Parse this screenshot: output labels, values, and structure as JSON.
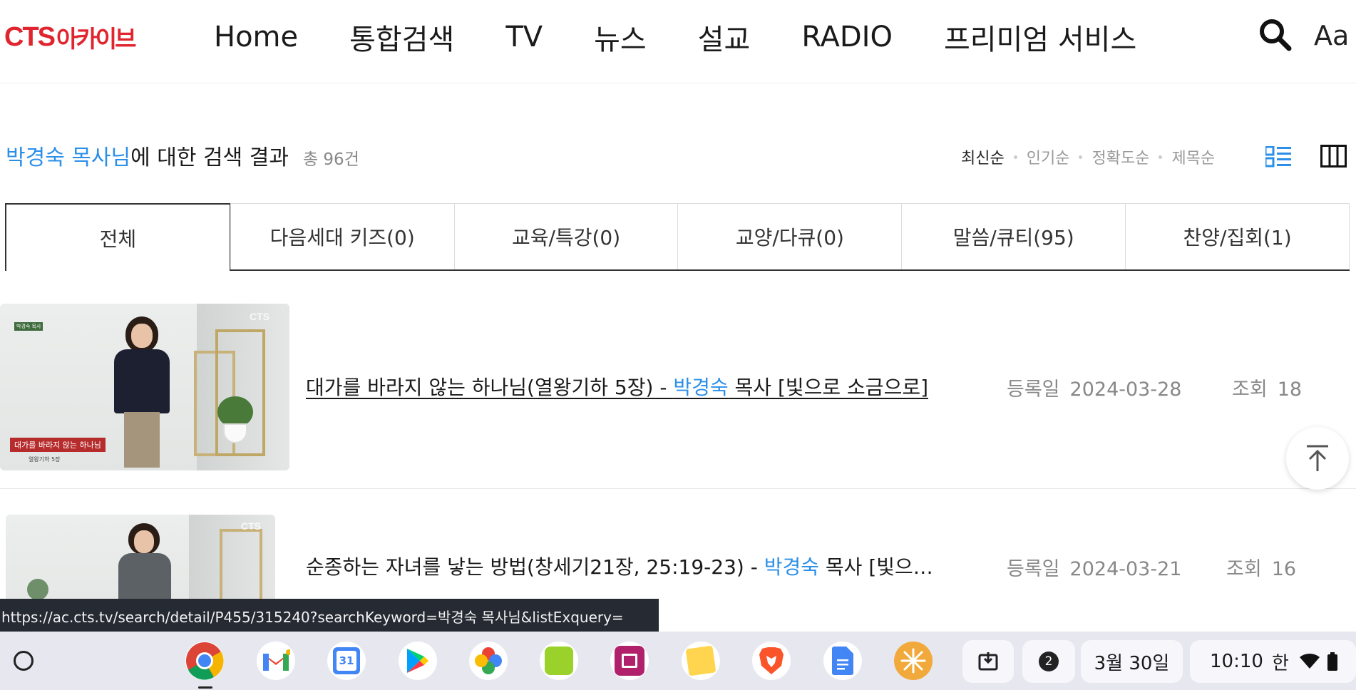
{
  "header": {
    "logo_cts": "CTS",
    "logo_archive": "아카이브",
    "nav": [
      {
        "label": "Home"
      },
      {
        "label": "통합검색"
      },
      {
        "label": "TV"
      },
      {
        "label": "뉴스"
      },
      {
        "label": "설교"
      },
      {
        "label": "RADIO"
      },
      {
        "label": "프리미엄 서비스"
      }
    ],
    "search_icon": "search-icon",
    "font_size_label": "Aa"
  },
  "results": {
    "keyword": "박경숙 목사님",
    "suffix": "에 대한 검색 결과",
    "total": "총 96건"
  },
  "sort": {
    "options": [
      "최신순",
      "인기순",
      "정확도순",
      "제목순"
    ],
    "active": "최신순"
  },
  "tabs": [
    {
      "label": "전체",
      "active": true
    },
    {
      "label": "다음세대 키즈(0)"
    },
    {
      "label": "교육/특강(0)"
    },
    {
      "label": "교양/다큐(0)"
    },
    {
      "label": "말씀/큐티(95)"
    },
    {
      "label": "찬양/집회(1)"
    }
  ],
  "items": [
    {
      "title_before": "대가를 바라지 않는 하나님(열왕기하 5장) - ",
      "title_keyword": "박경숙",
      "title_after": " 목사 [빛으로 소금으로]",
      "date_label": "등록일",
      "date": "2024-03-28",
      "views_label": "조회",
      "views": "18",
      "thumb_caption": "대가를 바라지 않는 하나님",
      "thumb_sub": "열왕기하 5장",
      "thumb_tag": "박경숙 목사",
      "thumb_mark": "CTS"
    },
    {
      "title_before": "순종하는 자녀를 낳는 방법(창세기21장, 25:19-23) - ",
      "title_keyword": "박경숙",
      "title_after": " 목사 [빛으…",
      "date_label": "등록일",
      "date": "2024-03-21",
      "views_label": "조회",
      "views": "16",
      "thumb_mark": "CTS"
    }
  ],
  "status_url": "https://ac.cts.tv/search/detail/P455/315240?searchKeyword=박경숙 목사님&listExquery=",
  "shelf": {
    "apps": [
      "chrome-icon",
      "gmail-icon",
      "calendar-icon",
      "play-store-icon",
      "photos-icon",
      "bible-app-icon",
      "book-app-icon",
      "notes-icon",
      "brave-icon",
      "docs-icon",
      "snowflake-app-icon"
    ],
    "calendar_day": "31",
    "notification_count": "2",
    "date": "3월 30일",
    "time": "10:10",
    "ime": "한",
    "colors": {
      "accent": "#2b8fe8",
      "brand": "#e0252f"
    }
  }
}
